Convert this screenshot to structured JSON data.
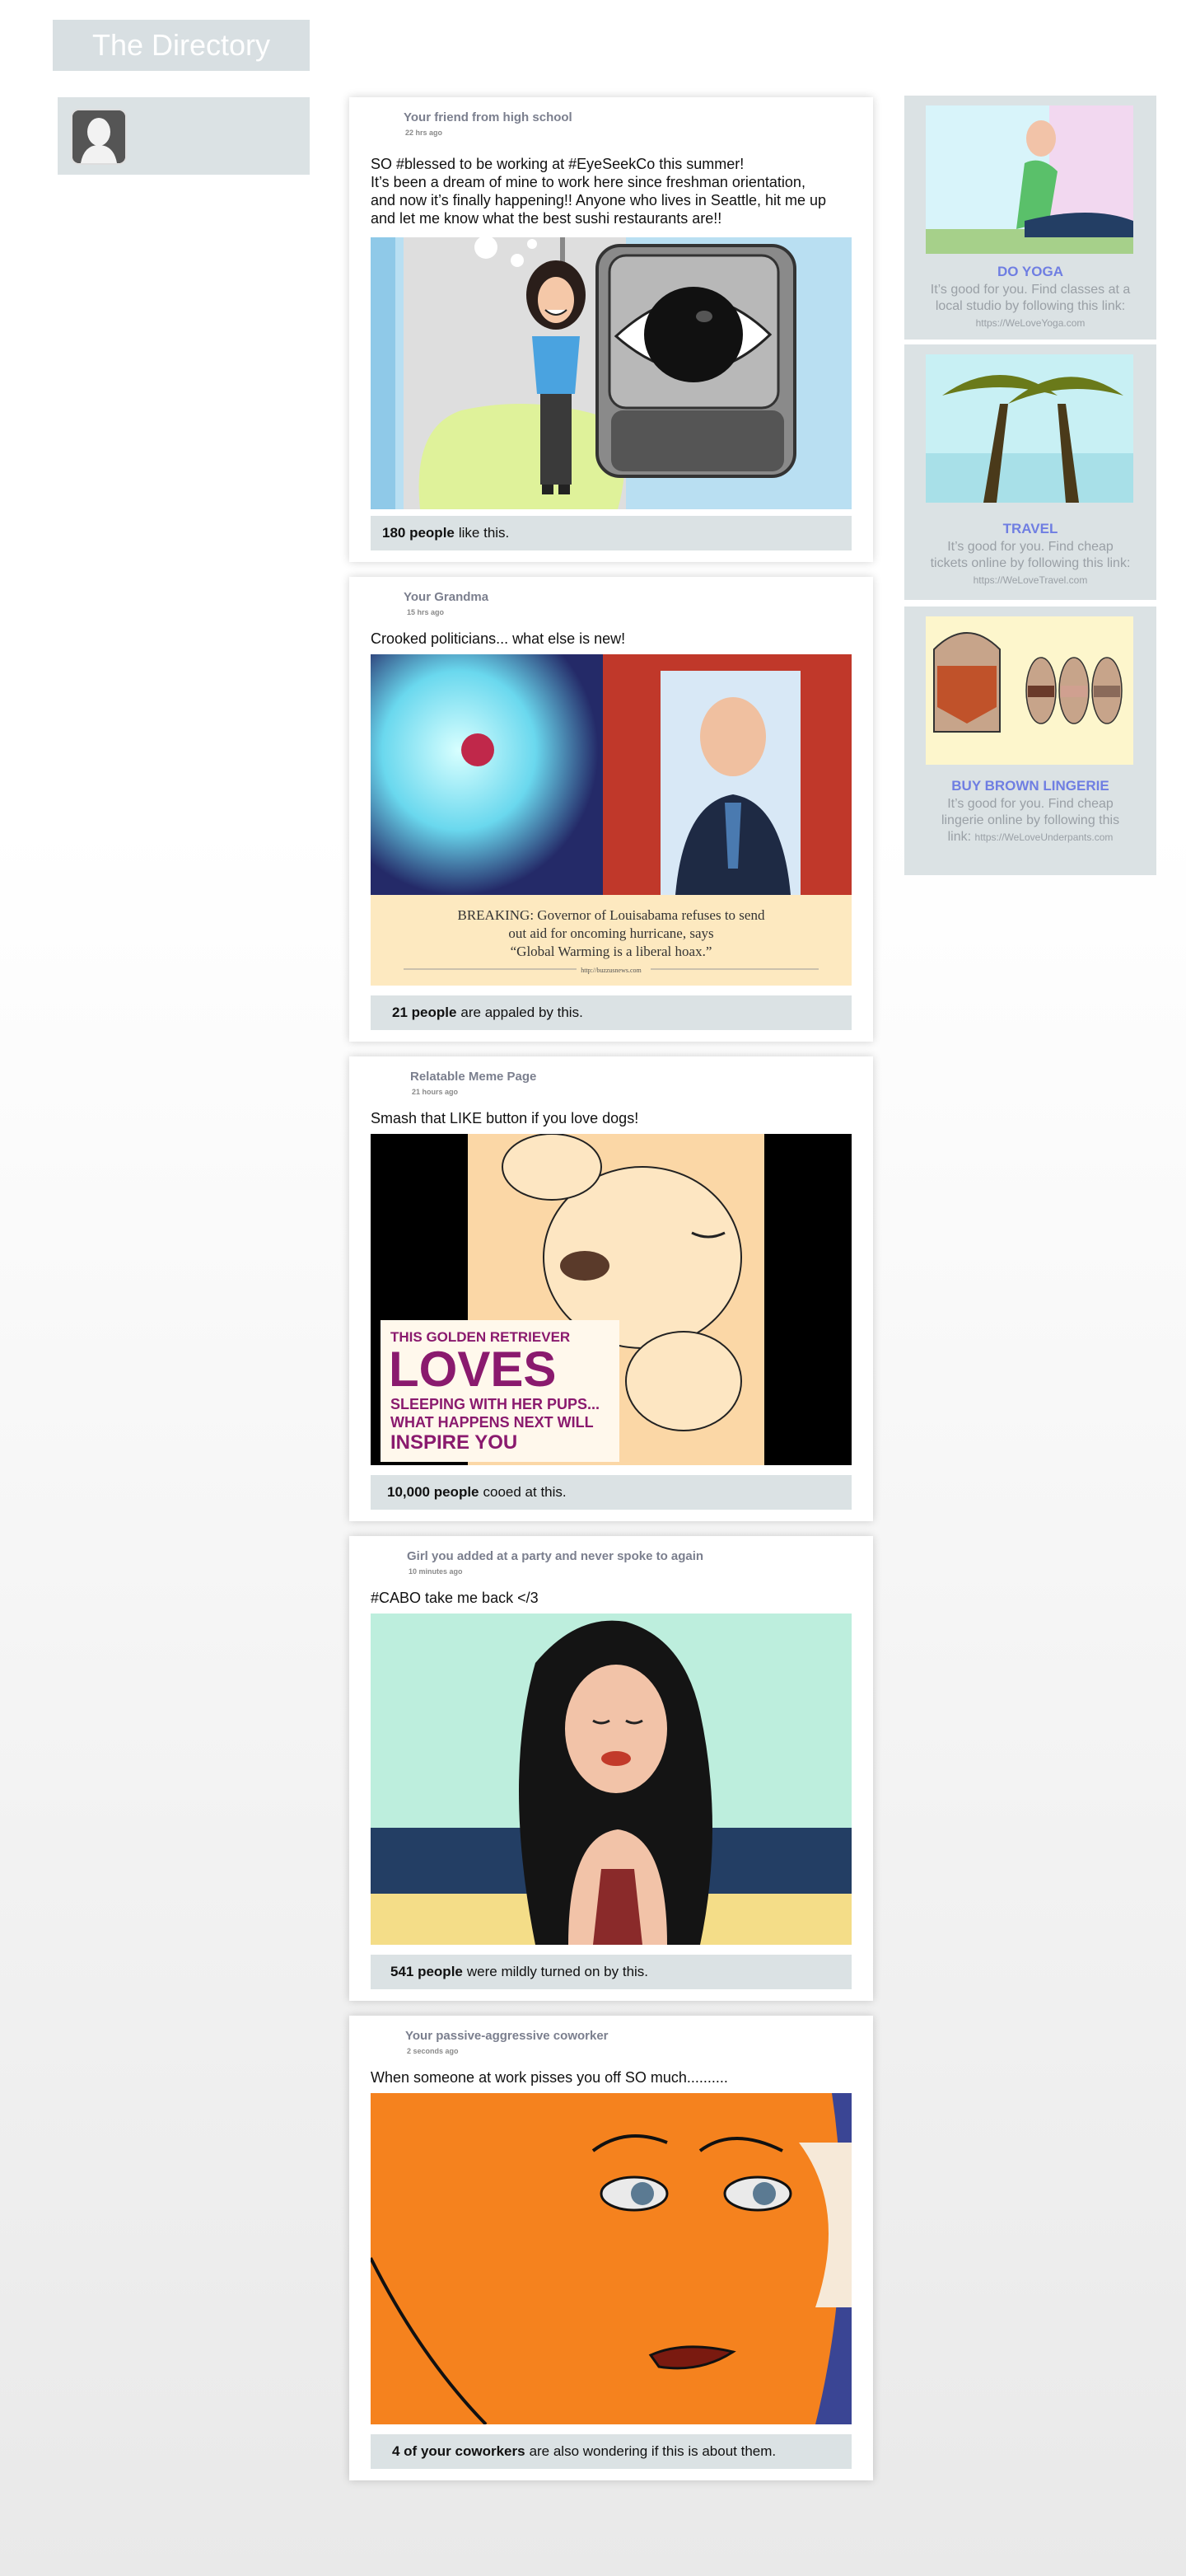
{
  "app": {
    "logo": "The Directory"
  },
  "posts": [
    {
      "author": "Your friend from high school",
      "time": "22 hrs ago",
      "text": "SO #blessed to be working at #EyeSeekCo this summer!\nIt’s been a dream of mine to work here since freshman orientation,\nand now it’s finally happening!! Anyone who lives in Seattle, hit me up\nand let me know what the best sushi restaurants are!!",
      "reaction_count": "180 people",
      "reaction_text": "like this."
    },
    {
      "author": "Your Grandma",
      "time": "15 hrs ago",
      "text": "Crooked politicians... what else is new!",
      "image_caption_1": "BREAKING: Governor of Louisabama refuses to send",
      "image_caption_2": "out aid for oncoming hurricane, says",
      "image_caption_3": "“Global Warming is a liberal hoax.”",
      "image_source": "http://buzzusnews.com",
      "reaction_count": "21 people",
      "reaction_text": "are appaled by this."
    },
    {
      "author": "Relatable Meme Page",
      "time": "21 hours ago",
      "text": "Smash that LIKE button if you love dogs!",
      "meme_line_1": "THIS GOLDEN RETRIEVER",
      "meme_line_2": "LOVES",
      "meme_line_3": "SLEEPING WITH HER PUPS...",
      "meme_line_4": "WHAT HAPPENS NEXT WILL",
      "meme_line_5": "INSPIRE YOU",
      "reaction_count": "10,000 people",
      "reaction_text": "cooed at this."
    },
    {
      "author": "Girl you added at a party and never spoke to again",
      "time": "10 minutes ago",
      "text": "#CABO take me back </3",
      "reaction_count": "541 people",
      "reaction_text": "were mildly turned on by this."
    },
    {
      "author": "Your passive-aggressive coworker",
      "time": "2 seconds ago",
      "text": "When someone at work pisses you off SO much..........",
      "reaction_count": "4 of your coworkers",
      "reaction_text": "are also wondering if this is about them."
    }
  ],
  "ads": [
    {
      "title": "DO YOGA",
      "body": "It’s good for you. Find classes at a local studio by following this link:",
      "link": "https://WeLoveYoga.com"
    },
    {
      "title": "TRAVEL",
      "body": "It’s good for you. Find cheap tickets online by following this link:",
      "link": "https://WeLoveTravel.com"
    },
    {
      "title": "BUY BROWN LINGERIE",
      "body": "It’s good for you. Find cheap lingerie online by following this link:",
      "link": "https://WeLoveUnderpants.com"
    }
  ],
  "colors": {
    "panel": "#dbe2e4",
    "ad_title": "#6f7ee2",
    "meme_purple": "#8a1a6e"
  }
}
